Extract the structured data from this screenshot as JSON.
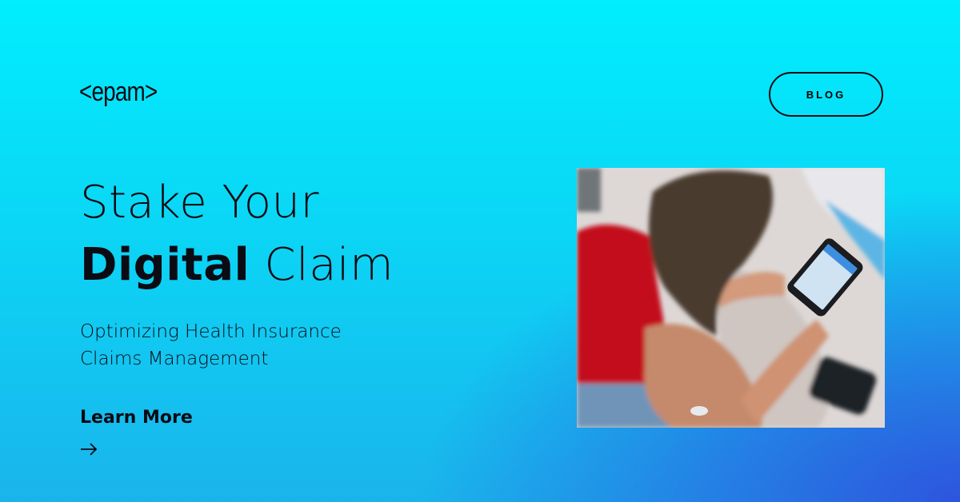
{
  "brand": {
    "logo_text": "<epam>"
  },
  "header": {
    "blog_label": "BLOG"
  },
  "hero": {
    "title_line1": "Stake Your",
    "title_bold": "Digital",
    "title_rest": "Claim",
    "subtitle_line1": "Optimizing Health Insurance",
    "subtitle_line2": "Claims Management",
    "cta_label": "Learn More",
    "cta_icon": "arrow-right-icon"
  },
  "image": {
    "alt": "Woman checking a glucose monitoring app on her smartphone"
  }
}
